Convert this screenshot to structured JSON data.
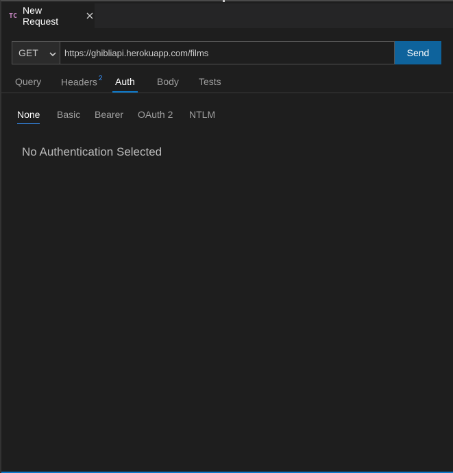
{
  "editor_tab": {
    "icon_text": "TC",
    "title": "New Request"
  },
  "request": {
    "method": "GET",
    "url": "https://ghibliapi.herokuapp.com/films",
    "send_label": "Send"
  },
  "tabs": {
    "query": "Query",
    "headers": "Headers",
    "headers_count": "2",
    "auth": "Auth",
    "body": "Body",
    "tests": "Tests",
    "active": "Auth"
  },
  "auth_types": {
    "none": "None",
    "basic": "Basic",
    "bearer": "Bearer",
    "oauth2": "OAuth 2",
    "ntlm": "NTLM",
    "active": "None"
  },
  "auth_panel": {
    "message": "No Authentication Selected"
  },
  "colors": {
    "accent": "#0e639c",
    "badge": "#3794ff",
    "icon": "#c586c0"
  }
}
